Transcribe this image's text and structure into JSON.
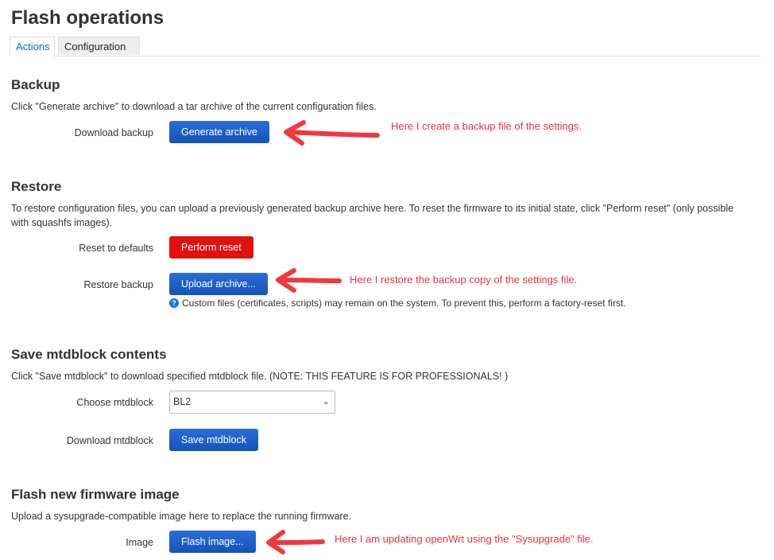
{
  "page": {
    "title": "Flash operations"
  },
  "tabs": [
    {
      "label": "Actions",
      "active": true
    },
    {
      "label": "Configuration",
      "active": false
    }
  ],
  "backup": {
    "heading": "Backup",
    "description": "Click \"Generate archive\" to download a tar archive of the current configuration files.",
    "download_label": "Download backup",
    "generate_button": "Generate archive",
    "annotation": "Here I create a backup file of the settings."
  },
  "restore": {
    "heading": "Restore",
    "description": "To restore configuration files, you can upload a previously generated backup archive here. To reset the firmware to its initial state, click \"Perform reset\" (only possible with squashfs images).",
    "reset_label": "Reset to defaults",
    "reset_button": "Perform reset",
    "restore_label": "Restore backup",
    "upload_button": "Upload archive...",
    "hint": "Custom files (certificates, scripts) may remain on the system. To prevent this, perform a factory-reset first.",
    "hint_icon": "?",
    "annotation": "Here I restore the backup copy of the settings file."
  },
  "mtd": {
    "heading": "Save mtdblock contents",
    "description": "Click \"Save mtdblock\" to download specified mtdblock file. (NOTE: THIS FEATURE IS FOR PROFESSIONALS! )",
    "choose_label": "Choose mtdblock",
    "selected": "BL2",
    "download_label": "Download mtdblock",
    "save_button": "Save mtdblock"
  },
  "flash": {
    "heading": "Flash new firmware image",
    "description": "Upload a sysupgrade-compatible image here to replace the running firmware.",
    "image_label": "Image",
    "flash_button": "Flash image...",
    "annotation": "Here I am updating openWrt using the \"Sysupgrade\" file."
  },
  "colors": {
    "accent": "#1f5dbf",
    "danger": "#e0110f",
    "annotation": "#e8323c"
  },
  "icons": {
    "help": "help-circle-icon",
    "dropdown": "chevron-down-icon",
    "arrow": "red-arrow-icon"
  }
}
